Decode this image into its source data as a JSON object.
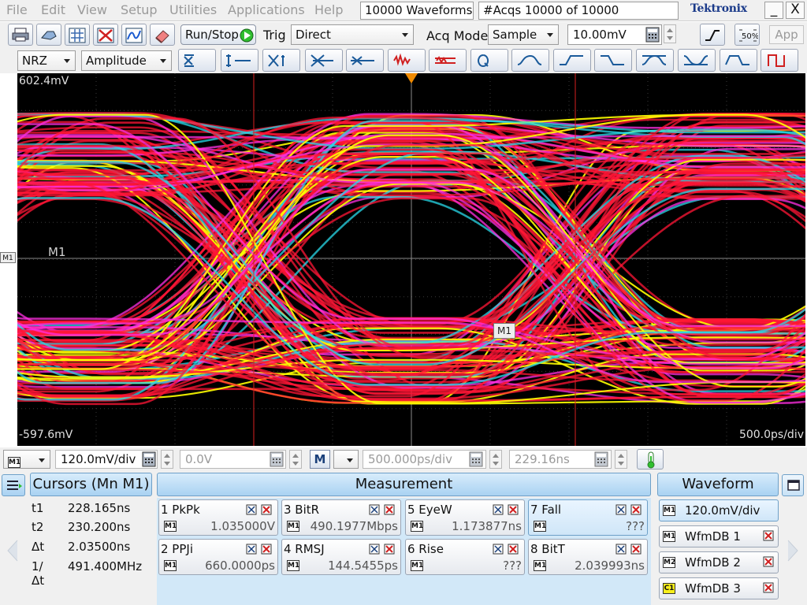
{
  "menubar": {
    "items": [
      "File",
      "Edit",
      "View",
      "Setup",
      "Utilities",
      "Applications",
      "Help"
    ],
    "waveforms_select": "10000 Waveforms",
    "acqs_status": "#Acqs  10000 of 10000",
    "logo": "Tektronix",
    "minimize": "_",
    "close": "X"
  },
  "toolbar1": {
    "run_stop": "Run/Stop",
    "trig_label": "Trig",
    "trig_value": "Direct",
    "acq_mode_label": "Acq Mode",
    "acq_mode_value": "Sample",
    "threshold_value": "10.00mV",
    "persist_label": "50%",
    "app_label": "App"
  },
  "toolbar2": {
    "encoding": "NRZ",
    "measurement_type": "Amplitude"
  },
  "scope": {
    "top_voltage": "602.4mV",
    "bottom_voltage": "-597.6mV",
    "timebase": "500.0ps/div",
    "marker_left": "M1",
    "marker_center": "M1",
    "channel_tag": "M1"
  },
  "settings": {
    "source_tag": "M1",
    "vertical_scale": "120.0mV/div",
    "offset": "0.0V",
    "math_tag": "M",
    "horizontal_scale": "500.000ps/div",
    "position": "229.16ns"
  },
  "cursors": {
    "title": "Cursors (Mn M1)",
    "rows": [
      {
        "k": "t1",
        "v": "228.165ns"
      },
      {
        "k": "t2",
        "v": "230.200ns"
      },
      {
        "k": "Δt",
        "v": "2.03500ns"
      },
      {
        "k": "1/Δt",
        "v": "491.400MHz"
      }
    ]
  },
  "measurement": {
    "title": "Measurement",
    "items": [
      {
        "name": "1 PkPk",
        "value": "1.035000V"
      },
      {
        "name": "2 PPJi",
        "value": "660.0000ps"
      },
      {
        "name": "3 BitR",
        "value": "490.1977Mbps"
      },
      {
        "name": "4 RMSJ",
        "value": "144.5455ps"
      },
      {
        "name": "5 EyeW",
        "value": "1.173877ns"
      },
      {
        "name": "6 Rise",
        "value": "???"
      },
      {
        "name": "7 Fall",
        "value": "???"
      },
      {
        "name": "8 BitT",
        "value": "2.039993ns"
      }
    ]
  },
  "waveform": {
    "title": "Waveform",
    "items": [
      {
        "tag": "M1",
        "label": "120.0mV/div"
      },
      {
        "tag": "M1",
        "label": "WfmDB 1"
      },
      {
        "tag": "M2",
        "label": "WfmDB 2"
      },
      {
        "tag": "C1",
        "label": "WfmDB 3"
      }
    ]
  },
  "colors": {
    "trace_red": "#ff1535",
    "trace_magenta": "#ff2fe0",
    "trace_yellow": "#ffff00",
    "trace_cyan": "#28d8e8",
    "cursor_red": "#d82020",
    "trigger_orange": "#f08a00"
  }
}
